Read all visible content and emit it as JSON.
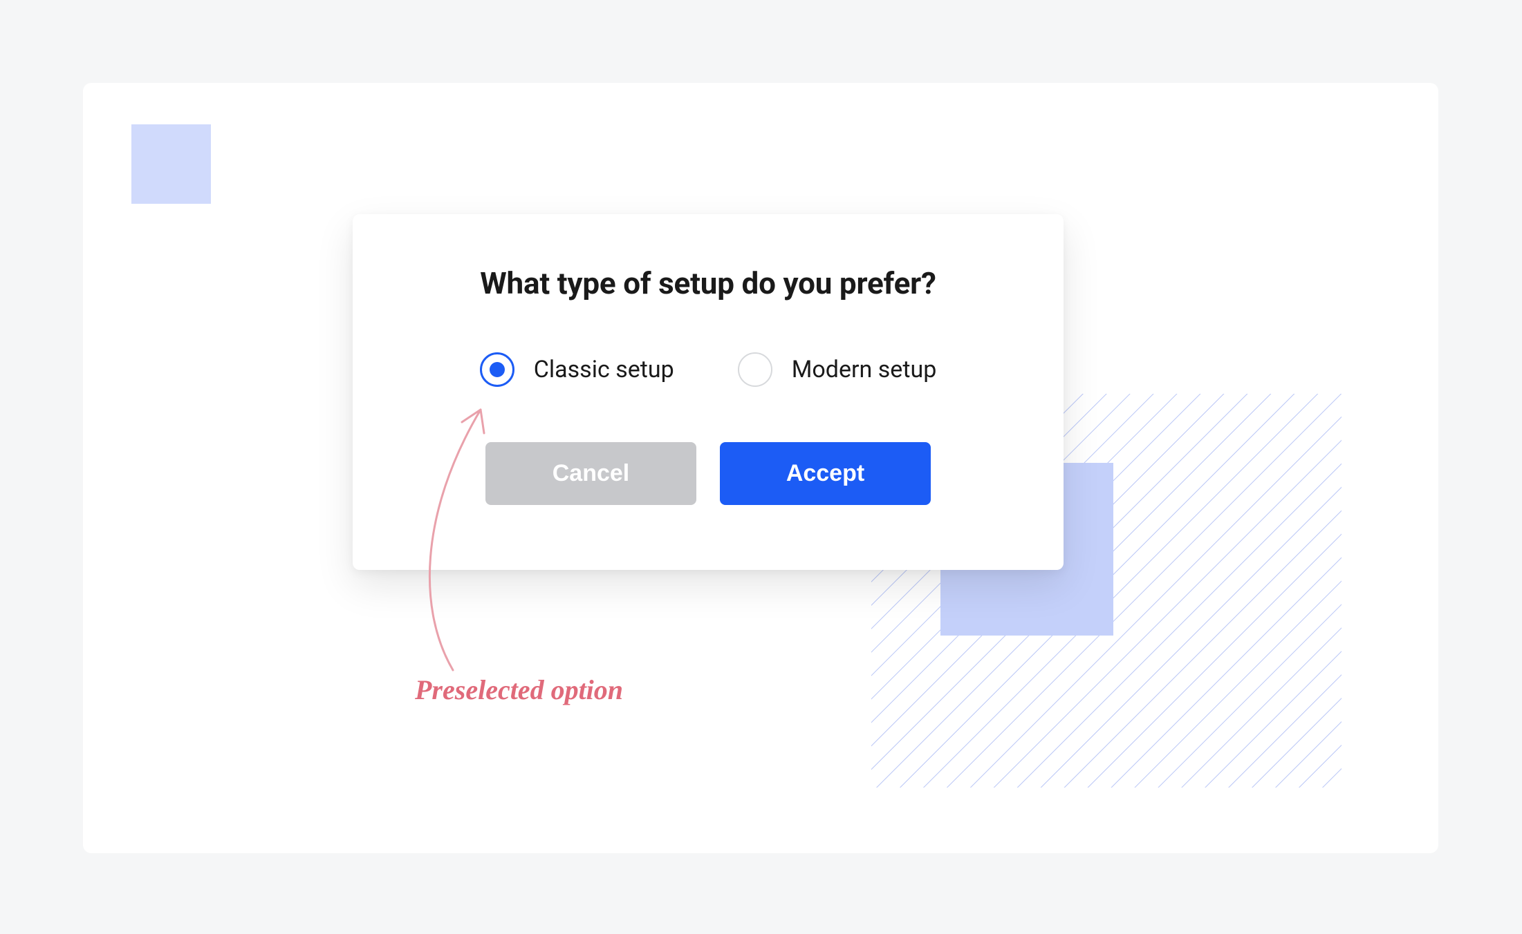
{
  "dialog": {
    "title": "What type of setup do you prefer?",
    "options": [
      {
        "label": "Classic setup",
        "selected": true
      },
      {
        "label": "Modern setup",
        "selected": false
      }
    ],
    "buttons": {
      "cancel": "Cancel",
      "accept": "Accept"
    }
  },
  "annotation": {
    "label": "Preselected option"
  },
  "colors": {
    "accent": "#1c5cf5",
    "annotation": "#e06a7a",
    "decorative_square": "#d0dafc"
  }
}
